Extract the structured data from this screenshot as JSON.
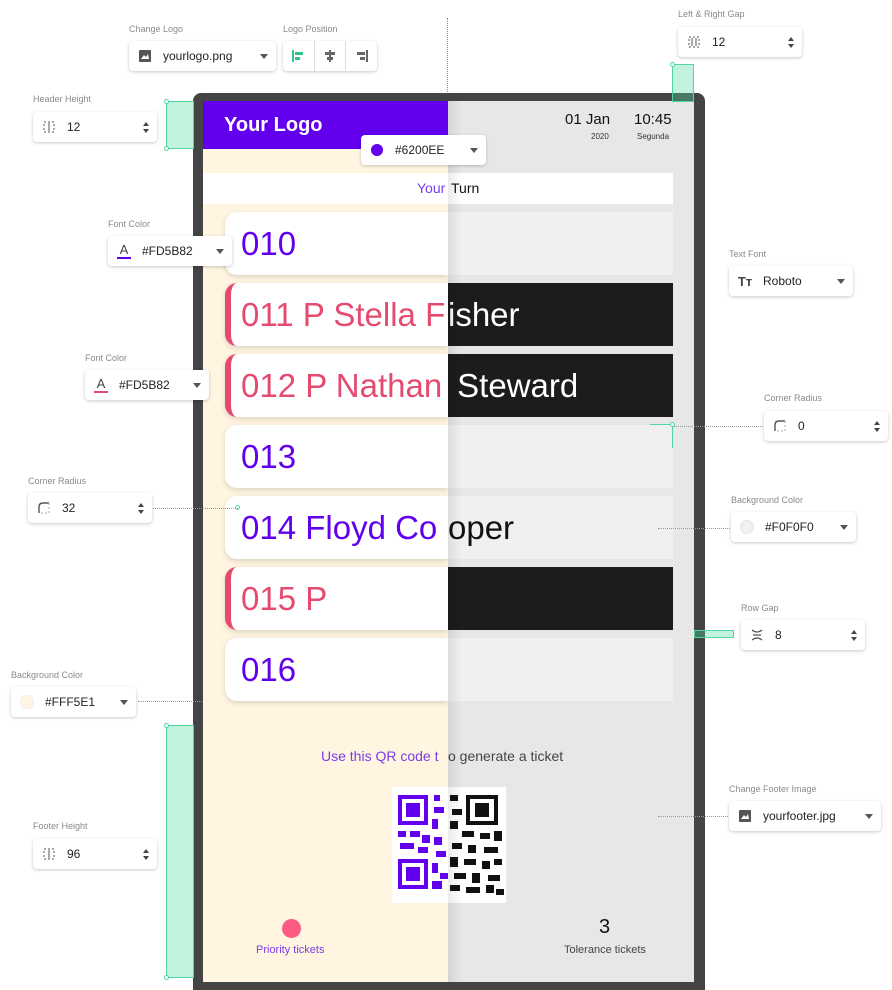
{
  "header": {
    "logo_text": "Your Logo",
    "date": "01 Jan",
    "year": "2020",
    "time": "10:45",
    "weekday": "Segunda"
  },
  "turn": {
    "left": "Your",
    "right": "Turn"
  },
  "rows": [
    {
      "left": "010",
      "right": "",
      "priority": false,
      "dark": false
    },
    {
      "left": "011 P Stella F",
      "right": "isher",
      "priority": true,
      "dark": true
    },
    {
      "left": "012 P Nathan",
      "right": " Steward",
      "priority": true,
      "dark": true
    },
    {
      "left": "013",
      "right": "",
      "priority": false,
      "dark": false
    },
    {
      "left": "014 Floyd Co",
      "right": "oper",
      "priority": false,
      "dark": false
    },
    {
      "left": "015 P",
      "right": "",
      "priority": true,
      "dark": true
    },
    {
      "left": "016",
      "right": "",
      "priority": false,
      "dark": false
    }
  ],
  "footer": {
    "qr_text_left": "Use this QR code t",
    "qr_text_right": "o generate a ticket",
    "priority_label": "Priority tickets",
    "tolerance_count": "3",
    "tolerance_label": "Tolerance tickets"
  },
  "controls": {
    "change_logo": {
      "label": "Change Logo",
      "value": "yourlogo.png",
      "icon": "image-icon"
    },
    "logo_position": {
      "label": "Logo Position",
      "icons": [
        "align-left-icon",
        "align-center-icon",
        "align-right-icon"
      ]
    },
    "header_height": {
      "label": "Header Height",
      "value": "12",
      "icon": "height-icon"
    },
    "header_color": {
      "value": "#6200EE"
    },
    "font_color_1": {
      "label": "Font Color",
      "value": "#FD5B82",
      "icon": "font-color-icon"
    },
    "font_color_2": {
      "label": "Font Color",
      "value": "#FD5B82",
      "icon": "font-color-icon"
    },
    "corner_radius_left": {
      "label": "Corner Radius",
      "value": "32",
      "icon": "corner-icon"
    },
    "background_color_left": {
      "label": "Background Color",
      "value": "#FFF5E1"
    },
    "footer_height": {
      "label": "Footer Height",
      "value": "96",
      "icon": "height-icon"
    },
    "left_right_gap": {
      "label": "Left & Right Gap",
      "value": "12",
      "icon": "gap-icon"
    },
    "text_font": {
      "label": "Text Font",
      "value": "Roboto",
      "icon": "text-font-icon"
    },
    "corner_radius_right": {
      "label": "Corner Radius",
      "value": "0",
      "icon": "corner-icon"
    },
    "background_color_right": {
      "label": "Background Color",
      "value": "#F0F0F0"
    },
    "row_gap": {
      "label": "Row Gap",
      "value": "8",
      "icon": "row-gap-icon"
    },
    "change_footer": {
      "label": "Change Footer Image",
      "value": "yourfooter.jpg",
      "icon": "image-icon"
    }
  },
  "colors": {
    "primary": "#6200EE",
    "priority": "#FD5B82",
    "left_bg": "#FFF5E1",
    "right_bg": "#F0F0F0",
    "guide": "#52D6A0"
  }
}
